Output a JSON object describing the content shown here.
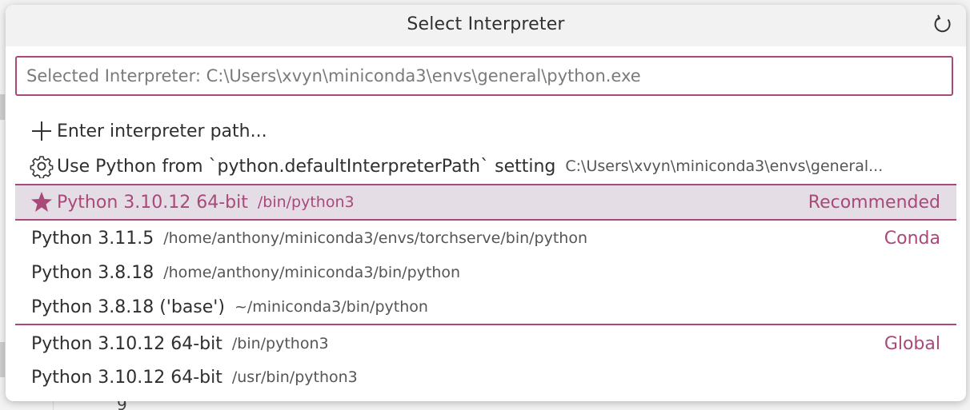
{
  "title": "Select Interpreter",
  "input": {
    "placeholder": "Selected Interpreter: C:\\Users\\xvyn\\miniconda3\\envs\\general\\python.exe",
    "value": ""
  },
  "items": [
    {
      "icon": "plus-icon",
      "label": "Enter interpreter path...",
      "description": "",
      "tag": ""
    },
    {
      "icon": "gear-icon",
      "label": "Use Python from `python.defaultInterpreterPath` setting",
      "description": "C:\\Users\\xvyn\\miniconda3\\envs\\general...",
      "tag": ""
    },
    {
      "icon": "star-icon",
      "label": "Python 3.10.12 64-bit",
      "description": "/bin/python3",
      "tag": "Recommended",
      "selected": true
    },
    {
      "label": "Python 3.11.5",
      "description": "/home/anthony/miniconda3/envs/torchserve/bin/python",
      "tag": "Conda"
    },
    {
      "label": "Python 3.8.18",
      "description": "/home/anthony/miniconda3/bin/python",
      "tag": ""
    },
    {
      "label": "Python 3.8.18 ('base')",
      "description": "~/miniconda3/bin/python",
      "tag": ""
    },
    {
      "label": "Python 3.10.12 64-bit",
      "description": "/bin/python3",
      "tag": "Global"
    },
    {
      "label": "Python 3.10.12 64-bit",
      "description": "/usr/bin/python3",
      "tag": ""
    }
  ],
  "background_editor": {
    "line_number": "9"
  },
  "colors": {
    "accent": "#a8497a",
    "selected_bg": "#e5dde6",
    "header_bg": "#f2f2f2"
  }
}
